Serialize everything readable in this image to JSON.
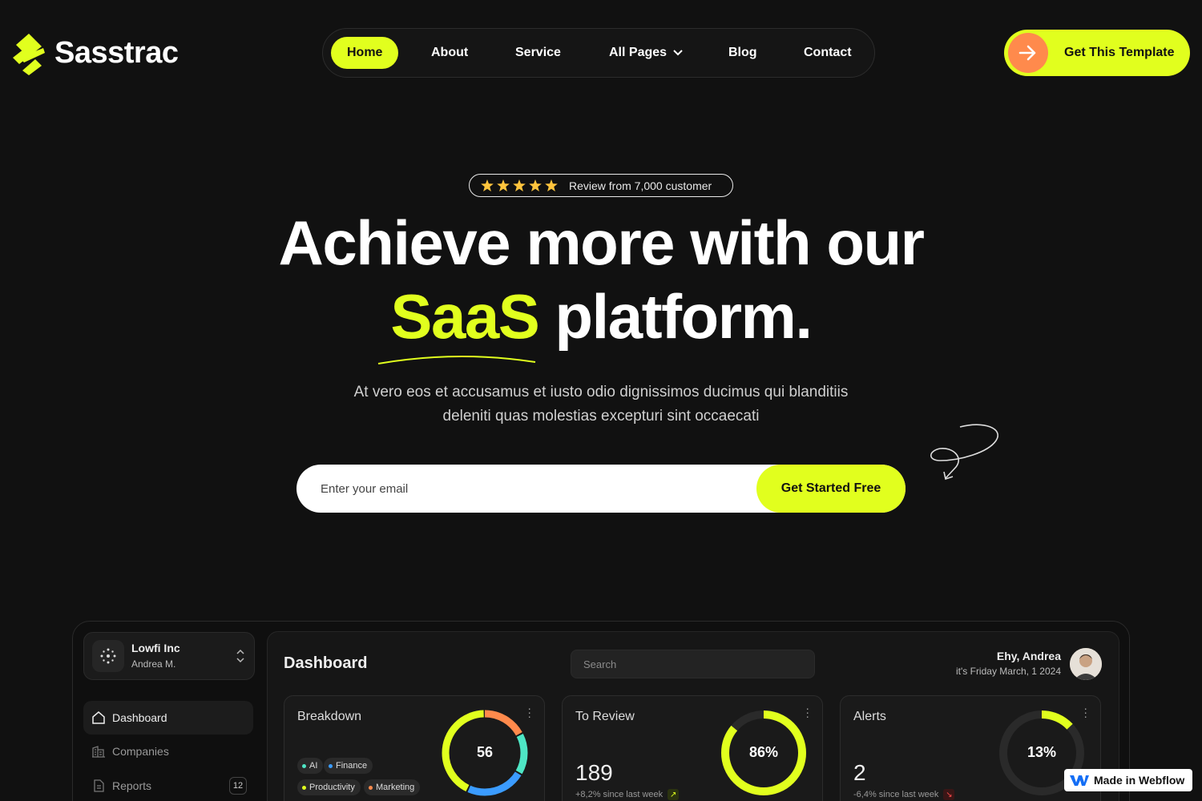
{
  "brand": {
    "name": "Sasstrac",
    "accent": "#e1ff1e",
    "orange": "#ff8a4c"
  },
  "nav": {
    "items": [
      {
        "label": "Home",
        "active": true
      },
      {
        "label": "About"
      },
      {
        "label": "Service"
      },
      {
        "label": "All Pages",
        "has_dropdown": true
      },
      {
        "label": "Blog"
      },
      {
        "label": "Contact"
      }
    ]
  },
  "header_cta": {
    "label": "Get This Template",
    "icon": "arrow-right-icon"
  },
  "hero": {
    "review_text": "Review from 7,000 customer",
    "stars": 5,
    "headline_line1": "Achieve more with our",
    "headline_highlight": "SaaS",
    "headline_rest": "platform.",
    "subtext_line1": "At vero eos et accusamus et iusto odio dignissimos ducimus qui blanditiis",
    "subtext_line2": "deleniti quas molestias excepturi sint occaecati",
    "email_placeholder": "Enter your email",
    "cta_label": "Get Started Free"
  },
  "dashboard": {
    "org_name": "Lowfi Inc",
    "org_user": "Andrea M.",
    "sidebar": [
      {
        "label": "Dashboard",
        "icon": "home-icon",
        "active": true
      },
      {
        "label": "Companies",
        "icon": "building-icon"
      },
      {
        "label": "Reports",
        "icon": "file-icon",
        "badge": "12"
      }
    ],
    "title": "Dashboard",
    "search_placeholder": "Search",
    "greeting": "Ehy, Andrea",
    "date": "it's Friday March, 1 2024",
    "cards": {
      "breakdown": {
        "title": "Breakdown",
        "value": "56",
        "tags": [
          {
            "label": "AI",
            "color": "#4ee6c5"
          },
          {
            "label": "Finance",
            "color": "#3b9cff"
          },
          {
            "label": "Productivity",
            "color": "#e1ff1e"
          },
          {
            "label": "Marketing",
            "color": "#ff8a4c"
          }
        ]
      },
      "review": {
        "title": "To Review",
        "count": "189",
        "delta": "+8,2% since last week",
        "percent": "86%",
        "fraction": 0.86
      },
      "alerts": {
        "title": "Alerts",
        "count": "2",
        "delta": "-6,4% since last week",
        "percent": "13%",
        "fraction": 0.13
      }
    }
  },
  "webflow_badge": "Made in Webflow"
}
